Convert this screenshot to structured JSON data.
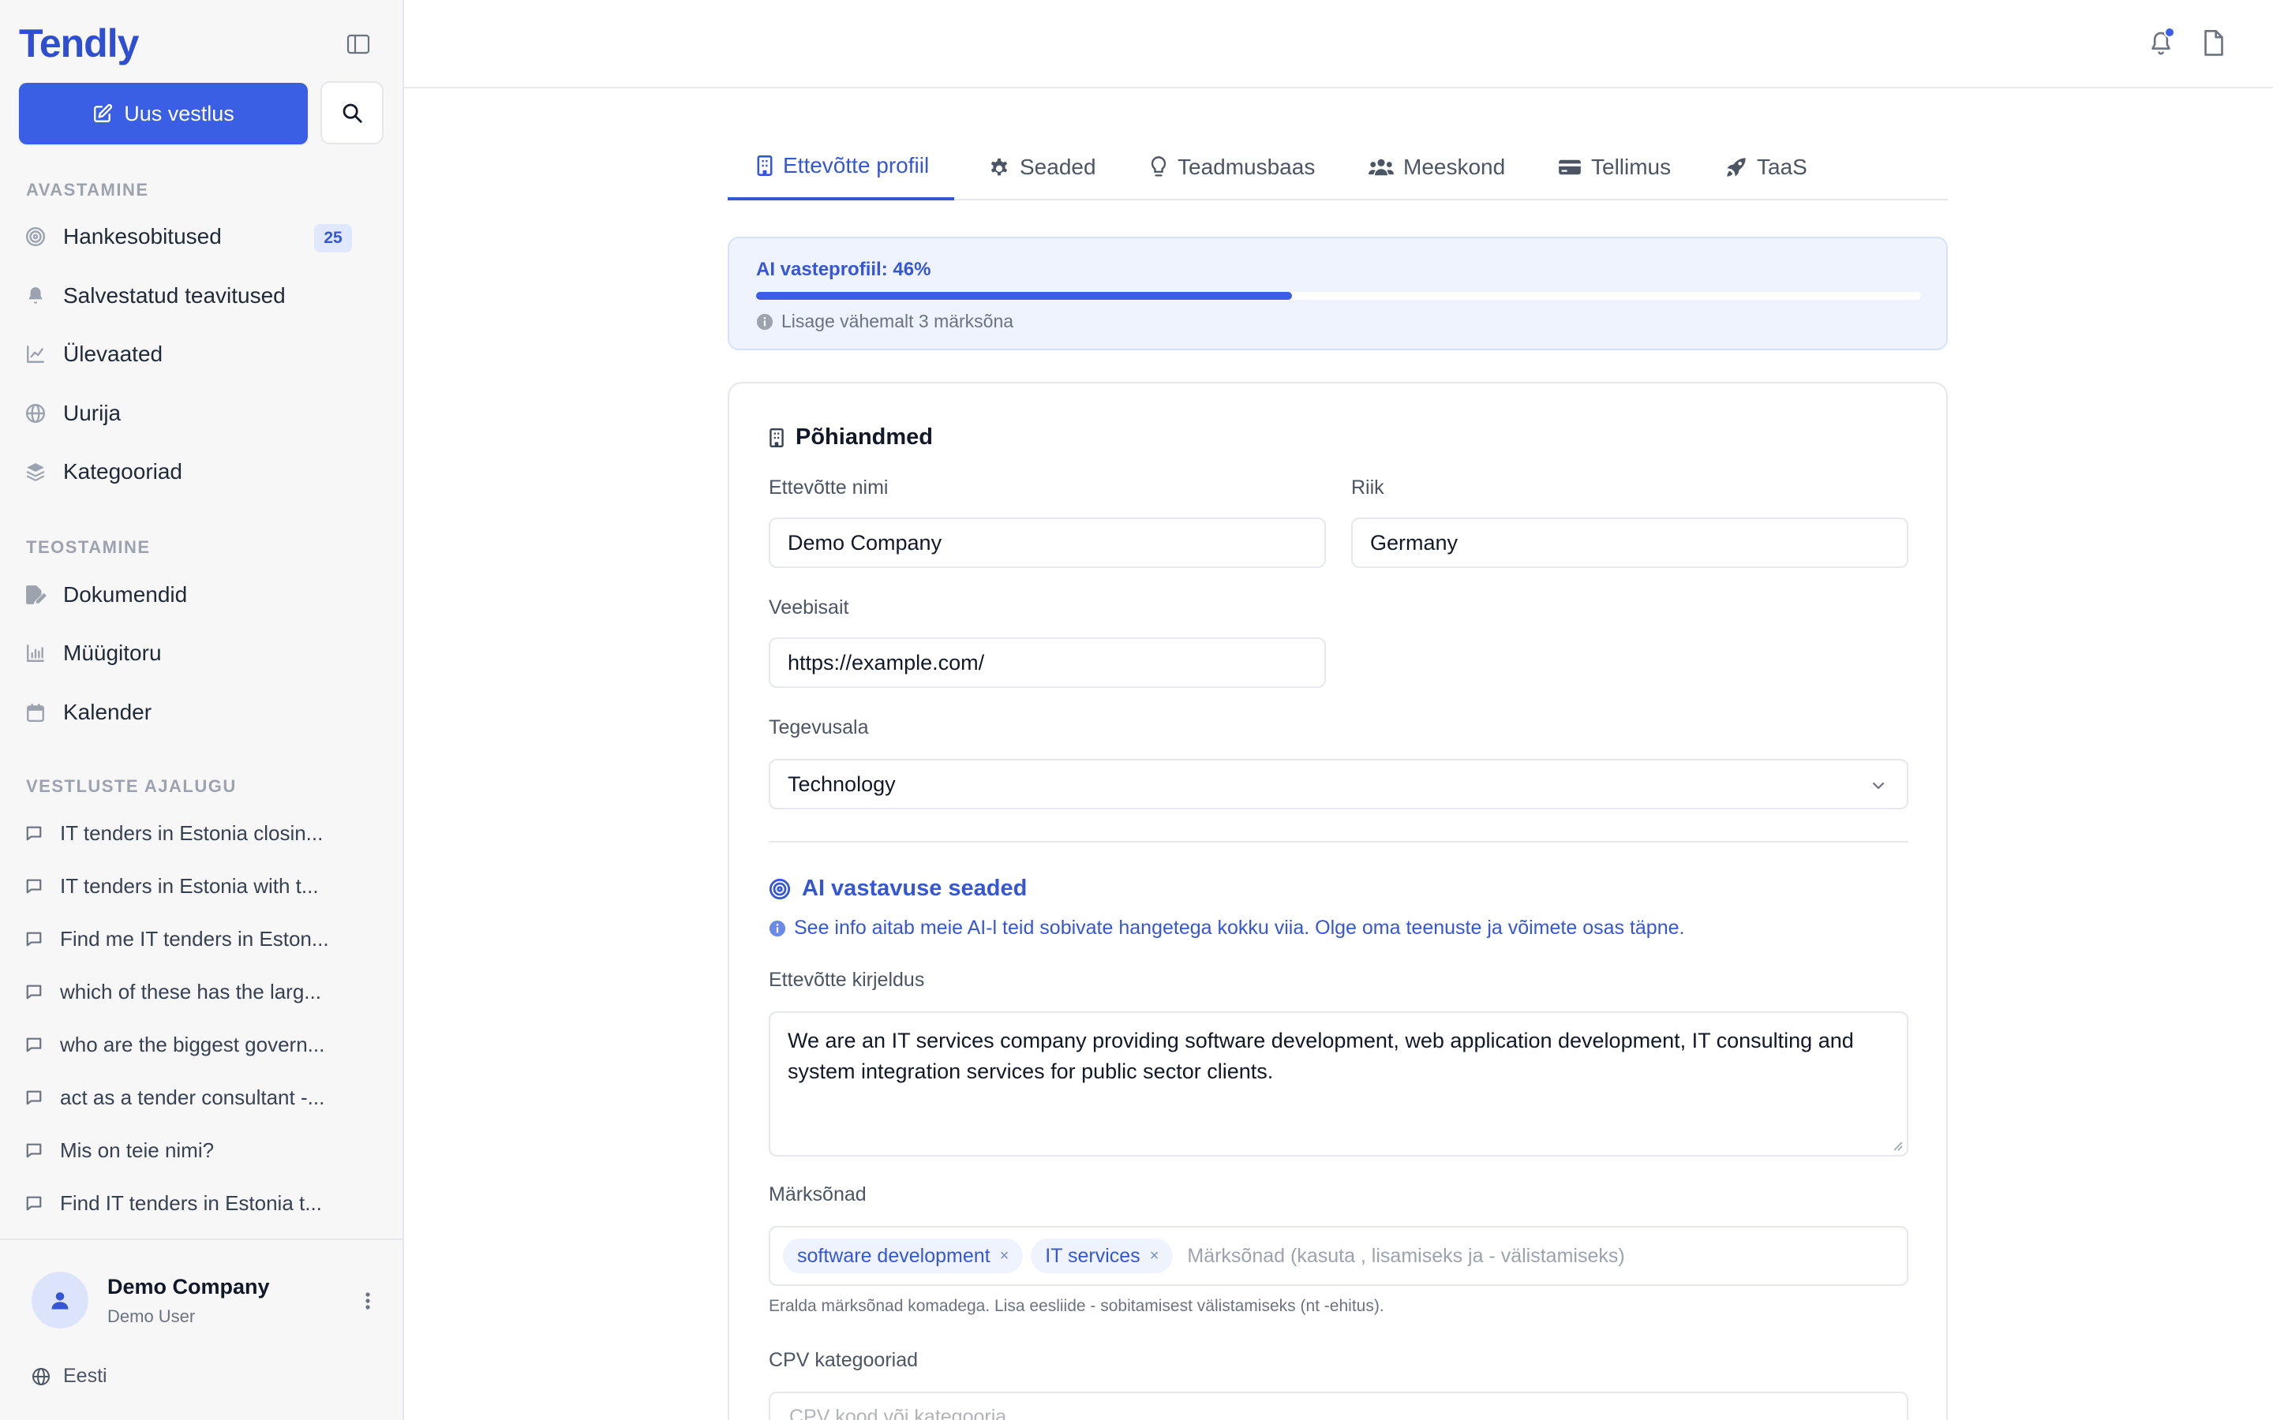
{
  "app": {
    "logo": "Tendly"
  },
  "sidebar": {
    "new_chat_label": "Uus vestlus",
    "sections": {
      "discover": "AVASTAMINE",
      "create": "TEOSTAMINE",
      "history": "VESTLUSTE AJALUGU"
    },
    "discover_items": [
      {
        "label": "Hankesobitused",
        "icon": "target-icon",
        "badge": "25"
      },
      {
        "label": "Salvestatud teavitused",
        "icon": "bell-icon"
      },
      {
        "label": "Ülevaated",
        "icon": "line-chart-icon"
      },
      {
        "label": "Uurija",
        "icon": "globe-icon"
      },
      {
        "label": "Kategooriad",
        "icon": "layers-icon"
      }
    ],
    "create_items": [
      {
        "label": "Dokumendid",
        "icon": "file-edit-icon"
      },
      {
        "label": "Müügitoru",
        "icon": "bar-chart-icon"
      },
      {
        "label": "Kalender",
        "icon": "calendar-icon"
      }
    ],
    "history": [
      "IT tenders in Estonia closin...",
      "IT tenders in Estonia with t...",
      "Find me IT tenders in Eston...",
      "which of these has the larg...",
      "who are the biggest govern...",
      "act as a tender consultant -...",
      "Mis on teie nimi?",
      "Find IT tenders in Estonia t..."
    ],
    "user": {
      "name": "Demo Company",
      "role": "Demo User"
    },
    "language": "Eesti"
  },
  "tabs": [
    {
      "label": "Ettevõtte profiil",
      "icon": "building-icon",
      "active": true
    },
    {
      "label": "Seaded",
      "icon": "gear-icon"
    },
    {
      "label": "Teadmusbaas",
      "icon": "lightbulb-icon"
    },
    {
      "label": "Meeskond",
      "icon": "users-icon"
    },
    {
      "label": "Tellimus",
      "icon": "credit-card-icon"
    },
    {
      "label": "TaaS",
      "icon": "rocket-icon"
    }
  ],
  "profile_progress": {
    "title": "AI vasteprofiil: 46%",
    "percent": 46,
    "hint": "Lisage vähemalt 3 märksõna"
  },
  "basic": {
    "heading": "Põhiandmed",
    "company_name_label": "Ettevõtte nimi",
    "company_name": "Demo Company",
    "country_label": "Riik",
    "country": "Germany",
    "website_label": "Veebisait",
    "website": "https://example.com/",
    "industry_label": "Tegevusala",
    "industry": "Technology"
  },
  "ai": {
    "heading": "AI vastavuse seaded",
    "info": "See info aitab meie AI-l teid sobivate hangetega kokku viia. Olge oma teenuste ja võimete osas täpne.",
    "description_label": "Ettevõtte kirjeldus",
    "description": "We are an IT services company providing software development, web application development, IT consulting and system integration services for public sector clients.",
    "keywords_label": "Märksõnad",
    "keywords": [
      "software development",
      "IT services"
    ],
    "keywords_placeholder": "Märksõnad (kasuta , lisamiseks ja - välistamiseks)",
    "keywords_help": "Eralda märksõnad komadega. Lisa eesliide - sobitamisest välistamiseks (nt -ehitus).",
    "cpv_label": "CPV kategooriad",
    "cpv_placeholder": "CPV kood või kategooria"
  },
  "colors": {
    "accent": "#3a5ee4",
    "accent_text": "#3557d6",
    "sidebar_bg": "#f7f7f8",
    "badge_bg": "#e0e8ff"
  }
}
